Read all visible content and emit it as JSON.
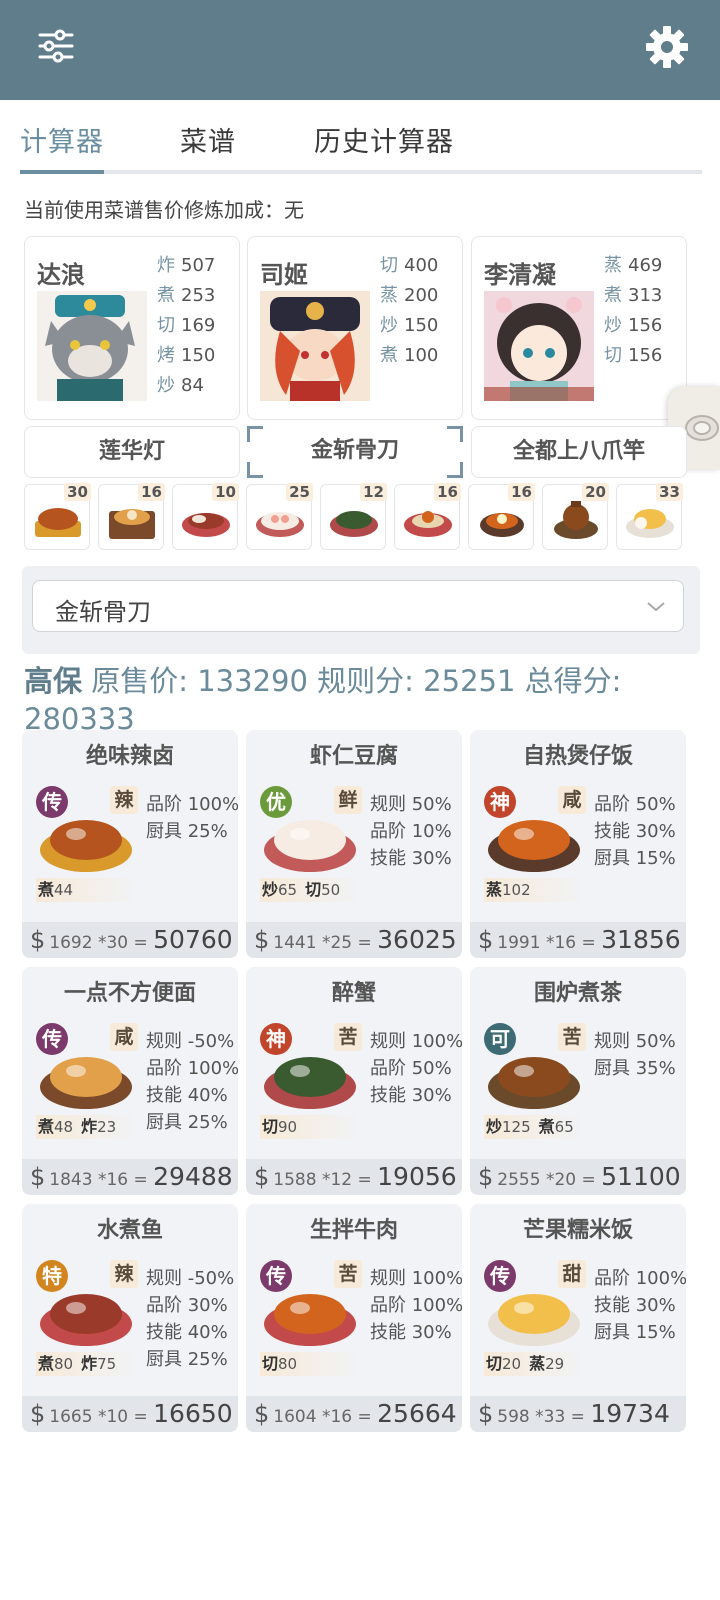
{
  "toolbar": {
    "menu_icon": "sliders-icon",
    "settings_icon": "gear-icon",
    "color": "#607d8b"
  },
  "tabs": [
    {
      "label": "计算器",
      "active": true
    },
    {
      "label": "菜谱",
      "active": false
    },
    {
      "label": "历史计算器",
      "active": false
    }
  ],
  "notice": "当前使用菜谱售价修炼加成：无",
  "chefs": [
    {
      "name": "达浪",
      "skills": [
        {
          "k": "炸",
          "v": "507"
        },
        {
          "k": "煮",
          "v": "253"
        },
        {
          "k": "切",
          "v": "169"
        },
        {
          "k": "烤",
          "v": "150"
        },
        {
          "k": "炒",
          "v": "84"
        }
      ]
    },
    {
      "name": "司姬",
      "skills": [
        {
          "k": "切",
          "v": "400"
        },
        {
          "k": "蒸",
          "v": "200"
        },
        {
          "k": "炒",
          "v": "150"
        },
        {
          "k": "煮",
          "v": "100"
        }
      ]
    },
    {
      "name": "李清凝",
      "skills": [
        {
          "k": "蒸",
          "v": "469"
        },
        {
          "k": "煮",
          "v": "313"
        },
        {
          "k": "炒",
          "v": "156"
        },
        {
          "k": "切",
          "v": "156"
        }
      ]
    }
  ],
  "equips": [
    "莲华灯",
    "金斩骨刀",
    "全都上八爪竿"
  ],
  "selected_equip_index": 1,
  "dish_counts": [
    "30",
    "16",
    "10",
    "25",
    "12",
    "16",
    "16",
    "20",
    "33"
  ],
  "select": {
    "value": "金斩骨刀"
  },
  "summary": {
    "grade": "高保",
    "orig_label": "原售价:",
    "orig": "133290",
    "rule_label": "规则分:",
    "rule": "25251",
    "total_label": "总得分:",
    "total": "280333"
  },
  "cards": [
    {
      "title": "绝味辣卤",
      "rarity": "传",
      "rarity_color": "#7b3a6b",
      "taste": "辣",
      "attrs": [
        "品阶 100%",
        "厨具 25%"
      ],
      "ingr": [
        {
          "k": "煮",
          "v": "44"
        }
      ],
      "price": "1692 *30",
      "total": "50760"
    },
    {
      "title": "虾仁豆腐",
      "rarity": "优",
      "rarity_color": "#6a9a3a",
      "taste": "鲜",
      "attrs": [
        "规则 50%",
        "品阶 10%",
        "技能 30%"
      ],
      "ingr": [
        {
          "k": "炒",
          "v": "65"
        },
        {
          "k": "切",
          "v": "50"
        }
      ],
      "price": "1441 *25",
      "total": "36025"
    },
    {
      "title": "自热煲仔饭",
      "rarity": "神",
      "rarity_color": "#c0452a",
      "taste": "咸",
      "attrs": [
        "品阶 50%",
        "技能 30%",
        "厨具 15%"
      ],
      "ingr": [
        {
          "k": "蒸",
          "v": "102"
        }
      ],
      "price": "1991 *16",
      "total": "31856"
    },
    {
      "title": "一点不方便面",
      "rarity": "传",
      "rarity_color": "#7b3a6b",
      "taste": "咸",
      "attrs": [
        "规则 -50%",
        "品阶 100%",
        "技能 40%",
        "厨具 25%"
      ],
      "ingr": [
        {
          "k": "煮",
          "v": "48"
        },
        {
          "k": "炸",
          "v": "23"
        }
      ],
      "price": "1843 *16",
      "total": "29488"
    },
    {
      "title": "醉蟹",
      "rarity": "神",
      "rarity_color": "#c0452a",
      "taste": "苦",
      "attrs": [
        "规则 100%",
        "品阶 50%",
        "技能 30%"
      ],
      "ingr": [
        {
          "k": "切",
          "v": "90"
        }
      ],
      "price": "1588 *12",
      "total": "19056"
    },
    {
      "title": "围炉煮茶",
      "rarity": "可",
      "rarity_color": "#3e6a74",
      "taste": "苦",
      "attrs": [
        "规则 50%",
        "厨具 35%"
      ],
      "ingr": [
        {
          "k": "炒",
          "v": "125"
        },
        {
          "k": "煮",
          "v": "65"
        }
      ],
      "price": "2555 *20",
      "total": "51100"
    },
    {
      "title": "水煮鱼",
      "rarity": "特",
      "rarity_color": "#d2841e",
      "taste": "辣",
      "attrs": [
        "规则 -50%",
        "品阶 30%",
        "技能 40%",
        "厨具 25%"
      ],
      "ingr": [
        {
          "k": "煮",
          "v": "80"
        },
        {
          "k": "炸",
          "v": "75"
        }
      ],
      "price": "1665 *10",
      "total": "16650"
    },
    {
      "title": "生拌牛肉",
      "rarity": "传",
      "rarity_color": "#7b3a6b",
      "taste": "苦",
      "attrs": [
        "规则 100%",
        "品阶 100%",
        "技能 30%"
      ],
      "ingr": [
        {
          "k": "切",
          "v": "80"
        }
      ],
      "price": "1604 *16",
      "total": "25664"
    },
    {
      "title": "芒果糯米饭",
      "rarity": "传",
      "rarity_color": "#7b3a6b",
      "taste": "甜",
      "attrs": [
        "品阶 100%",
        "技能 30%",
        "厨具 15%"
      ],
      "ingr": [
        {
          "k": "切",
          "v": "20"
        },
        {
          "k": "蒸",
          "v": "29"
        }
      ],
      "price": "598 *33",
      "total": "19734"
    }
  ]
}
